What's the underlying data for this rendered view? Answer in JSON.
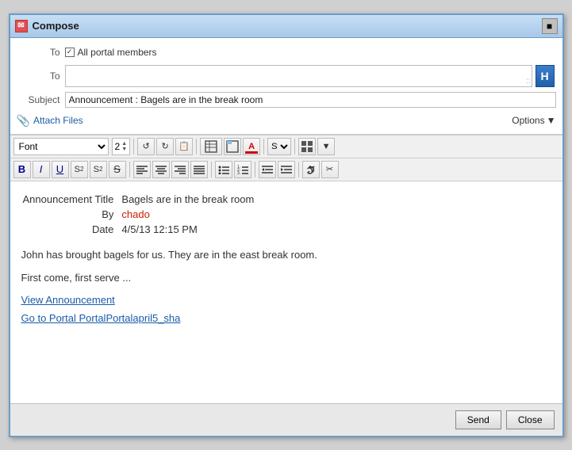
{
  "window": {
    "title": "Compose",
    "title_icon": "✉",
    "close_icon": "■"
  },
  "header": {
    "to_label": "To",
    "to_checkbox_checked": true,
    "to_all_members": "All portal members",
    "to2_label": "To",
    "subject_label": "Subject",
    "subject_value": "Announcement : Bagels are in the break room",
    "attach_label": "Attach Files",
    "options_label": "Options"
  },
  "toolbar": {
    "font_placeholder": "Font",
    "font_size": "2",
    "btn_undo": "↺",
    "btn_redo": "↻",
    "btn_paste": "📋",
    "options_arrow": "▼"
  },
  "formatting": {
    "bold": "B",
    "italic": "I",
    "underline": "U",
    "subscript": "S₂",
    "superscript": "S²",
    "strikethrough": "S",
    "align_left": "≡",
    "align_center": "≡",
    "align_right": "≡",
    "align_justify": "≡",
    "list_unordered": "≡",
    "list_ordered": "≡",
    "outdent": "⇤",
    "indent": "⇥",
    "link": "🔗",
    "unlink": "✂"
  },
  "content": {
    "ann_title_label": "Announcement Title",
    "ann_title_value": "Bagels are in the break room",
    "by_label": "By",
    "by_value": "chado",
    "date_label": "Date",
    "date_value": "4/5/13 12:15 PM",
    "body_line1": "John has brought bagels for us. They are in the east break room.",
    "body_line2": "First come, first serve ...",
    "link1": "View Announcement",
    "link2": "Go to Portal PortalPortalapril5_sha"
  },
  "footer": {
    "send_label": "Send",
    "close_label": "Close"
  }
}
